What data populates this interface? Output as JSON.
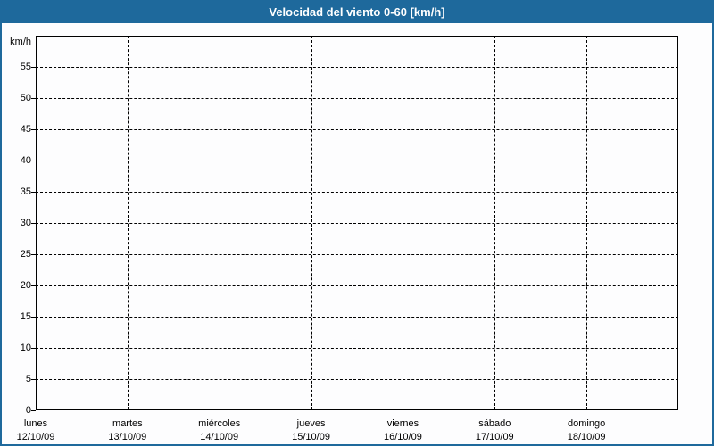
{
  "colors": {
    "titlebar_bg": "#1e699c",
    "frame_border": "#1e699c",
    "title_text": "#ffffff",
    "background": "#fdfdfe",
    "grid": "#000000",
    "label_text": "#000000"
  },
  "chart_data": {
    "type": "line",
    "title": "Velocidad del viento 0-60 [km/h]",
    "ylabel_unit": "km/h",
    "ylim": [
      0,
      60
    ],
    "yticks": [
      0,
      5,
      10,
      15,
      20,
      25,
      30,
      35,
      40,
      45,
      50,
      55
    ],
    "grid": "dashed",
    "legend": "none",
    "categories": [
      {
        "day": "lunes",
        "date": "12/10/09"
      },
      {
        "day": "martes",
        "date": "13/10/09"
      },
      {
        "day": "miércoles",
        "date": "14/10/09"
      },
      {
        "day": "jueves",
        "date": "15/10/09"
      },
      {
        "day": "viernes",
        "date": "16/10/09"
      },
      {
        "day": "sábado",
        "date": "17/10/09"
      },
      {
        "day": "domingo",
        "date": "18/10/09"
      }
    ],
    "series": []
  }
}
